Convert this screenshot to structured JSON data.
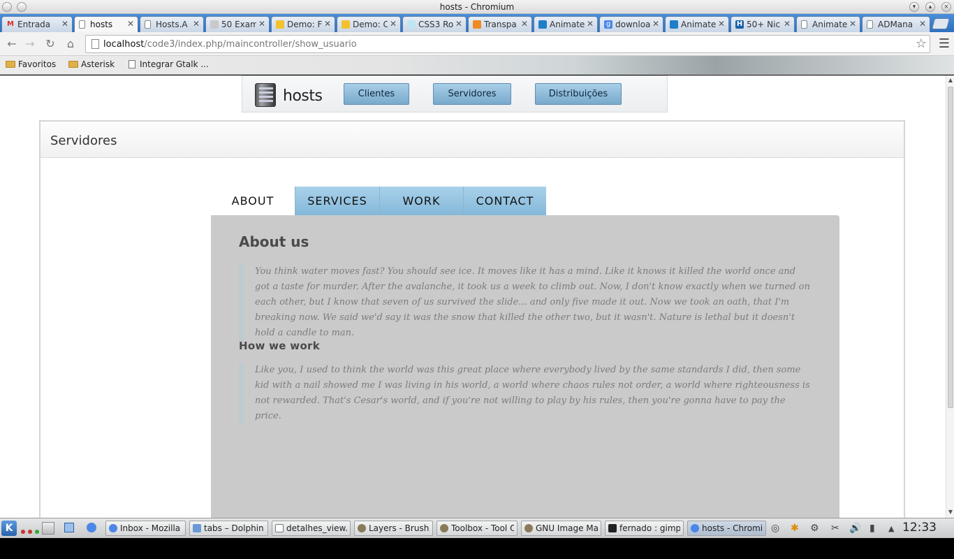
{
  "window": {
    "title": "hosts - Chromium"
  },
  "browser": {
    "tabs": [
      {
        "label": "Entrada",
        "icon": "gmail-icon",
        "color": "#d93025"
      },
      {
        "label": "hosts",
        "icon": "page-icon",
        "color": "#ffffff"
      },
      {
        "label": "Hosts.A",
        "icon": "page-icon",
        "color": "#ffffff"
      },
      {
        "label": "50 Exam",
        "icon": "site-icon",
        "color": "#c9c9c9"
      },
      {
        "label": "Demo: F",
        "icon": "site-icon",
        "color": "#f2c22e"
      },
      {
        "label": "Demo: C",
        "icon": "site-icon",
        "color": "#f2c22e"
      },
      {
        "label": "CSS3 Ro",
        "icon": "site-icon",
        "color": "#bfe4f2"
      },
      {
        "label": "Transpa",
        "icon": "site-icon",
        "color": "#f08a24"
      },
      {
        "label": "Animate",
        "icon": "site-icon",
        "color": "#1e7fc8"
      },
      {
        "label": "downloa",
        "icon": "google-icon",
        "color": "#4a87e8"
      },
      {
        "label": "Animate",
        "icon": "site-icon",
        "color": "#1e7fc8"
      },
      {
        "label": "50+ Nic",
        "icon": "site-icon",
        "color": "#1b5fa8"
      },
      {
        "label": "Animate",
        "icon": "page-icon",
        "color": "#ffffff"
      },
      {
        "label": "ADMana",
        "icon": "page-icon",
        "color": "#ffffff"
      }
    ],
    "url_host": "localhost",
    "url_path": "/code3/index.php/maincontroller/show_usuario",
    "bookmarks": [
      "Favoritos",
      "Asterisk",
      "Integrar Gtalk ..."
    ]
  },
  "site": {
    "logo_text": "hosts",
    "nav": [
      "Clientes",
      "Servidores",
      "Distribuições"
    ]
  },
  "panel": {
    "title": "Servidores"
  },
  "tabs_widget": {
    "tabs": [
      "ABOUT",
      "SERVICES",
      "WORK",
      "CONTACT"
    ],
    "content": {
      "heading": "About us",
      "quote1": "You think water moves fast? You should see ice. It moves like it has a mind. Like it knows it killed the world once and got a taste for murder. After the avalanche, it took us a week to climb out. Now, I don't know exactly when we turned on each other, but I know that seven of us survived the slide... and only five made it out. Now we took an oath, that I'm breaking now. We said we'd say it was the snow that killed the other two, but it wasn't. Nature is lethal but it doesn't hold a candle to man.",
      "subheading": "How we work",
      "quote2": "Like you, I used to think the world was this great place where everybody lived by the same standards I did, then some kid with a nail showed me I was living in his world, a world where chaos rules not order, a world where righteousness is not rewarded. That's Cesar's world, and if you're not willing to play by his rules, then you're gonna have to pay the price."
    }
  },
  "taskbar": {
    "tasks": [
      "Inbox - Mozilla",
      "tabs – Dolphin",
      "detalhes_view...",
      "Layers - Brushe...",
      "Toolbox - Tool O...",
      "GNU Image Ma...",
      "fernado : gimp",
      "hosts - Chromi..."
    ],
    "clock": "12:33"
  }
}
